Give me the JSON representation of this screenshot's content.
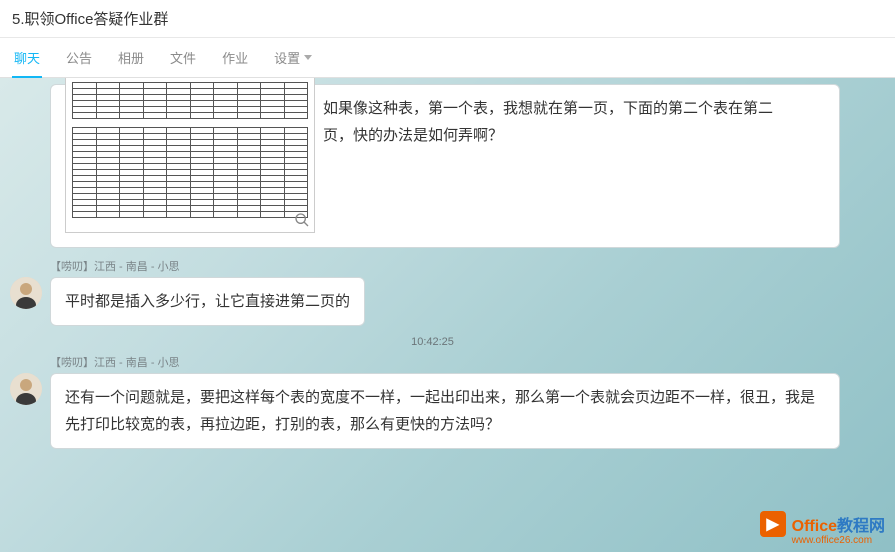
{
  "header": {
    "title": "5.职领Office答疑作业群"
  },
  "tabs": {
    "chat": "聊天",
    "announcement": "公告",
    "album": "相册",
    "files": "文件",
    "homework": "作业",
    "settings": "设置"
  },
  "messages": {
    "msg1": {
      "text_line1": "如果像这种表，第一个表，我想就在第一页，下面的第二个表在第二",
      "text_line2": "页，快的办法是如何弄啊？"
    },
    "msg2": {
      "sender_tag": "【唠叨】",
      "sender_location": "江西 - 南昌 - 小思",
      "text": "平时都是插入多少行，让它直接进第二页的"
    },
    "timestamp1": "10:42:25",
    "msg3": {
      "sender_tag": "【唠叨】",
      "sender_location": "江西 - 南昌 - 小思",
      "text": "还有一个问题就是，要把这样每个表的宽度不一样，一起出印出来，那么第一个表就会页边距不一样，很丑，我是先打印比较宽的表，再拉边距，打别的表，那么有更快的方法吗？"
    }
  },
  "watermark": {
    "brand_part1": "Office",
    "brand_part2": "教程网",
    "url": "www.office26.com"
  }
}
